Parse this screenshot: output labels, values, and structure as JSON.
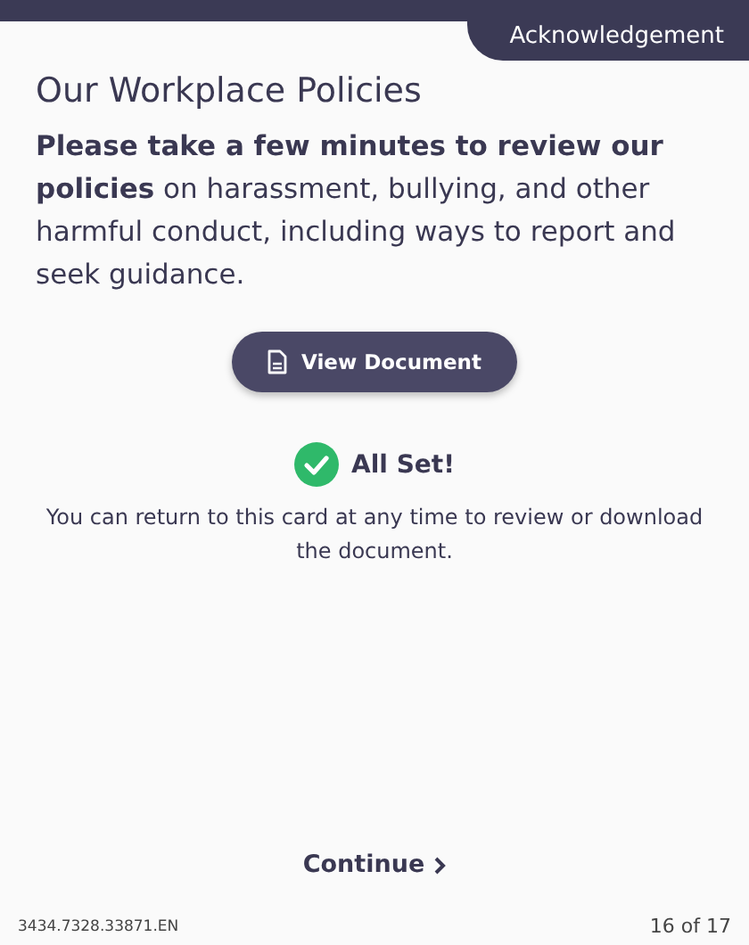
{
  "header": {
    "tab_label": "Acknowledgement"
  },
  "title": "Our Workplace Policies",
  "description": "**Please take a few minutes to review our policies** on harassment, bullying, and other harmful conduct, including ways to report and seek guidance.",
  "view_button": {
    "label": "View Document"
  },
  "status": {
    "label": "All Set!",
    "message": "You can return to this card at any time to review or download the document."
  },
  "continue_button": {
    "label": "Continue"
  },
  "footer": {
    "code": "3434.7328.33871.EN",
    "page": "16 of 17"
  }
}
